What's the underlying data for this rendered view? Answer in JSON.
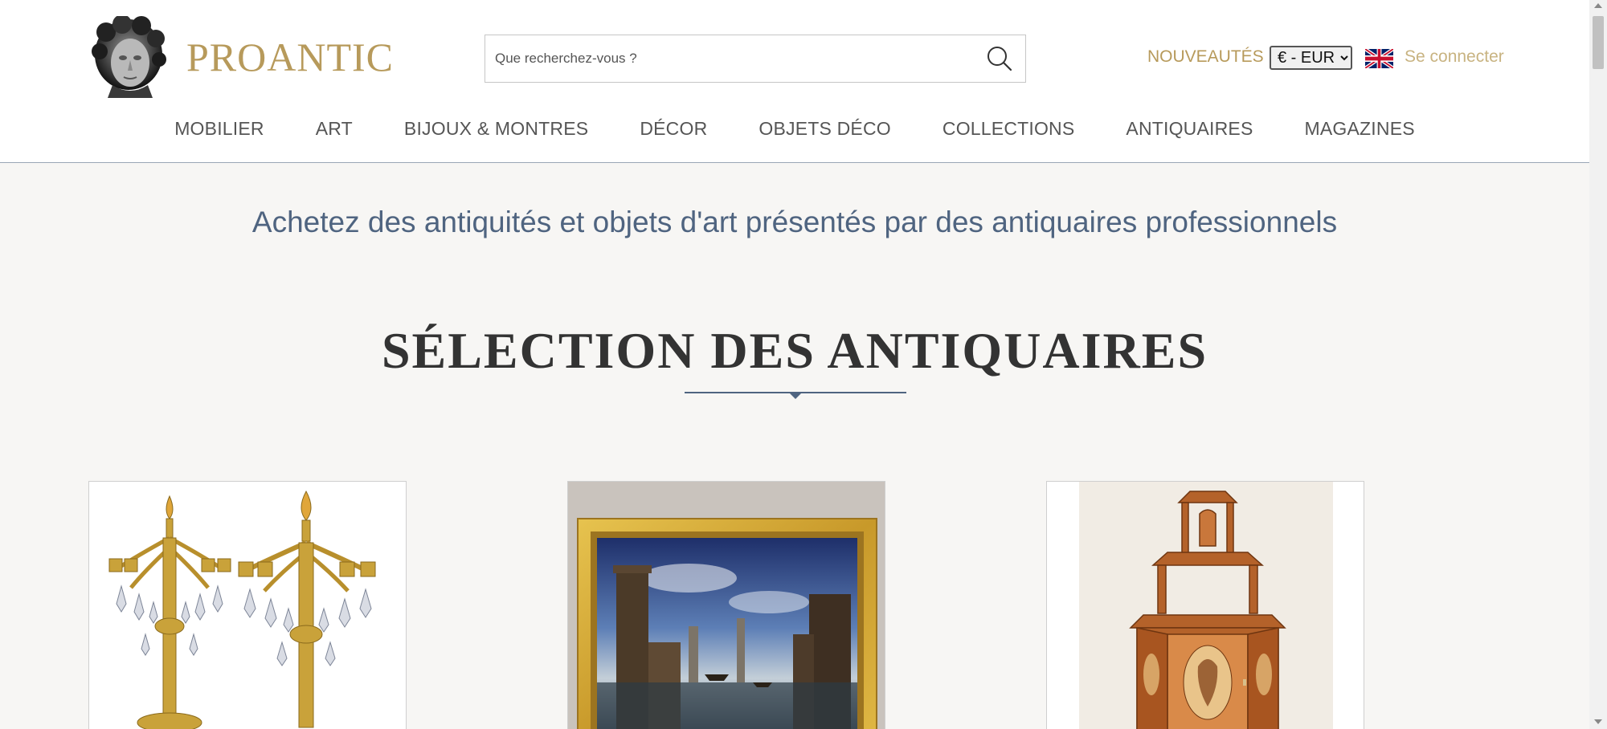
{
  "brand": {
    "name": "PROANTIC",
    "color": "#b79a5b"
  },
  "search": {
    "placeholder": "Que recherchez-vous ?"
  },
  "header": {
    "new_label": "NOUVEAUTÉS",
    "currency": {
      "selected": "€ - EUR",
      "options": [
        "€ - EUR"
      ]
    },
    "language_flag": "uk-flag-icon",
    "login_label": "Se connecter"
  },
  "nav": {
    "items": [
      {
        "label": "MOBILIER"
      },
      {
        "label": "ART"
      },
      {
        "label": "BIJOUX & MONTRES"
      },
      {
        "label": "DÉCOR"
      },
      {
        "label": "OBJETS DÉCO"
      },
      {
        "label": "COLLECTIONS"
      },
      {
        "label": "ANTIQUAIRES"
      },
      {
        "label": "MAGAZINES"
      }
    ]
  },
  "main": {
    "tagline": "Achetez des antiquités et objets d'art présentés par des antiquaires professionnels",
    "section_title": "SÉLECTION DES ANTIQUAIRES",
    "products": [
      {
        "image": "gilt-bronze-candelabra-pair"
      },
      {
        "image": "harbor-landscape-painting-gilt-frame"
      },
      {
        "image": "marquetry-corner-cabinet"
      }
    ]
  },
  "colors": {
    "accent": "#b79a5b",
    "slate": "#4f6480",
    "page_bg": "#f7f6f4"
  }
}
